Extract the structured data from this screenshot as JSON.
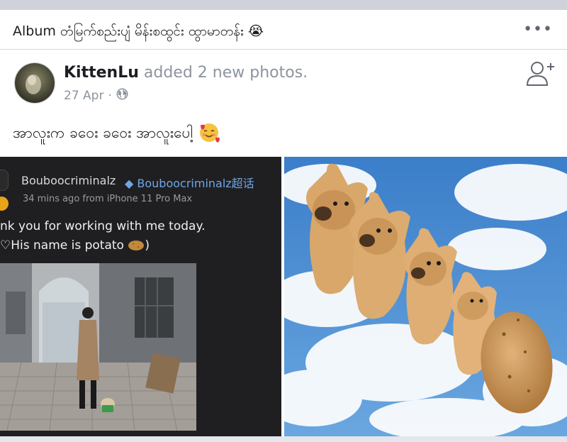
{
  "album": {
    "title": "Album တံမြက်စည်းပျံ မိန်းစထွင်း ထွာမာတန်း 😭",
    "more_label": "•••"
  },
  "post": {
    "author": "KittenLu",
    "action": "added 2 new photos.",
    "date": "27 Apr",
    "separator": "·",
    "text": "အာလူးက ခဝေး ခဝေး အာလူးပေါ့",
    "emoji": "🥰"
  },
  "photos": [
    {
      "username": "Bouboocriminalz",
      "topic": "Bouboocriminalz超话",
      "meta": "34 mins ago   from iPhone 11 Pro Max",
      "line1": "nk you for working with me today.",
      "line2": "His name is potato",
      "line2_end": ")"
    },
    {
      "subject": "dogs-in-sky"
    }
  ],
  "icons": {
    "privacy": "globe-icon",
    "add_friend": "add-friend-icon",
    "more": "more-icon",
    "potato": "potato-icon"
  },
  "colors": {
    "muted": "#8d949e",
    "link": "#6fa6e6",
    "sky": "#4a90d9"
  }
}
